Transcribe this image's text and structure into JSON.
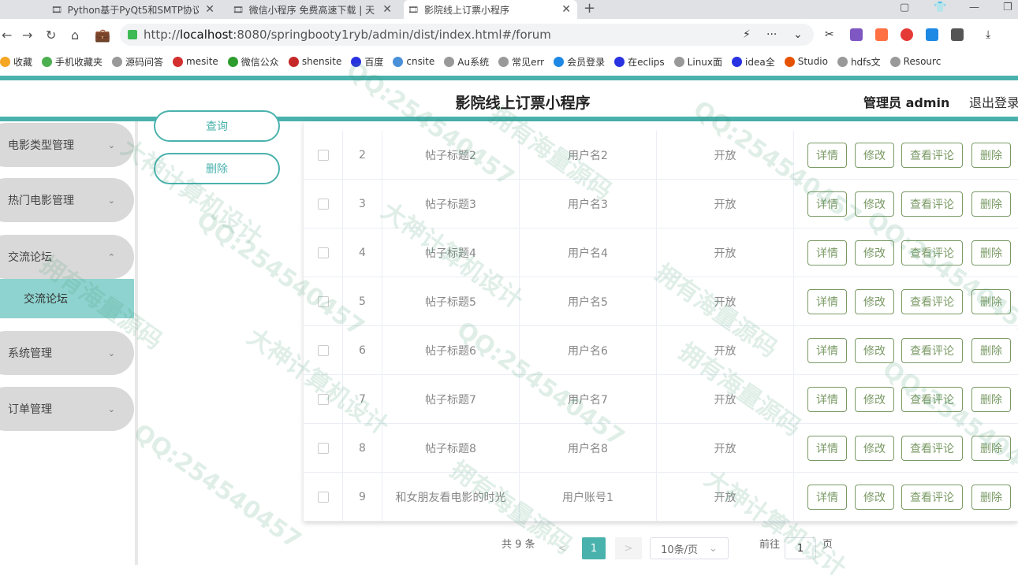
{
  "browser": {
    "tabs": [
      {
        "title": "Python基于PyQt5和SMTP协议",
        "icon": "tab-favicon"
      },
      {
        "title": "微信小程序 免费高速下载 | 天",
        "icon": "tab-favicon"
      },
      {
        "title": "影院线上订票小程序",
        "icon": "tab-favicon"
      }
    ],
    "new_tab": "+",
    "url_scheme": "http://",
    "url_host": "localhost",
    "url_rest": ":8080/springbooty1ryb/admin/dist/index.html#/forum",
    "url_more": "···",
    "bookmarks": [
      {
        "label": "收藏",
        "color": "#f5a623"
      },
      {
        "label": "手机收藏夹",
        "color": "#4caf50"
      },
      {
        "label": "源码问答",
        "color": "#999999"
      },
      {
        "label": "mesite",
        "color": "#d32f2f"
      },
      {
        "label": "微信公众",
        "color": "#2e9d2e"
      },
      {
        "label": "shensite",
        "color": "#c62828"
      },
      {
        "label": "百度",
        "color": "#2932e1"
      },
      {
        "label": "cnsite",
        "color": "#4a90d9"
      },
      {
        "label": "Au系统",
        "color": "#999999"
      },
      {
        "label": "常见err",
        "color": "#999999"
      },
      {
        "label": "会员登录",
        "color": "#1e88e5"
      },
      {
        "label": "在eclips",
        "color": "#2932e1"
      },
      {
        "label": "Linux面",
        "color": "#999999"
      },
      {
        "label": "idea全",
        "color": "#2932e1"
      },
      {
        "label": "Studio",
        "color": "#e65100"
      },
      {
        "label": "hdfs文",
        "color": "#999999"
      },
      {
        "label": "Resourc",
        "color": "#999999"
      }
    ]
  },
  "app": {
    "title": "影院线上订票小程序",
    "admin_label": "管理员 admin",
    "logout_label": "退出登录",
    "accent": "#4ab2ad"
  },
  "sidebar": {
    "items": [
      {
        "label": "电影类型管理"
      },
      {
        "label": "热门电影管理"
      },
      {
        "label": "交流论坛"
      },
      {
        "label": "系统管理"
      },
      {
        "label": "订单管理"
      }
    ],
    "subitem": "交流论坛"
  },
  "actions": {
    "search_label": "查询",
    "delete_label": "删除"
  },
  "table": {
    "rows": [
      {
        "id": "2",
        "title": "帖子标题2",
        "user": "用户名2",
        "status": "开放"
      },
      {
        "id": "3",
        "title": "帖子标题3",
        "user": "用户名3",
        "status": "开放"
      },
      {
        "id": "4",
        "title": "帖子标题4",
        "user": "用户名4",
        "status": "开放"
      },
      {
        "id": "5",
        "title": "帖子标题5",
        "user": "用户名5",
        "status": "开放"
      },
      {
        "id": "6",
        "title": "帖子标题6",
        "user": "用户名6",
        "status": "开放"
      },
      {
        "id": "7",
        "title": "帖子标题7",
        "user": "用户名7",
        "status": "开放"
      },
      {
        "id": "8",
        "title": "帖子标题8",
        "user": "用户名8",
        "status": "开放"
      },
      {
        "id": "9",
        "title": "和女朋友看电影的时光",
        "user": "用户账号1",
        "status": "开放"
      }
    ],
    "row_buttons": {
      "detail": "详情",
      "edit": "修改",
      "comments": "查看评论",
      "delete": "删除"
    }
  },
  "pagination": {
    "total_text": "共 9 条",
    "prev": "<",
    "current_page": "1",
    "next": ">",
    "page_size": "10条/页",
    "goto_prefix": "前往",
    "goto_value": "1",
    "goto_suffix": "页"
  },
  "watermarks": [
    "大神计算机设计",
    "QQ:254540457",
    "拥有海量源码"
  ]
}
